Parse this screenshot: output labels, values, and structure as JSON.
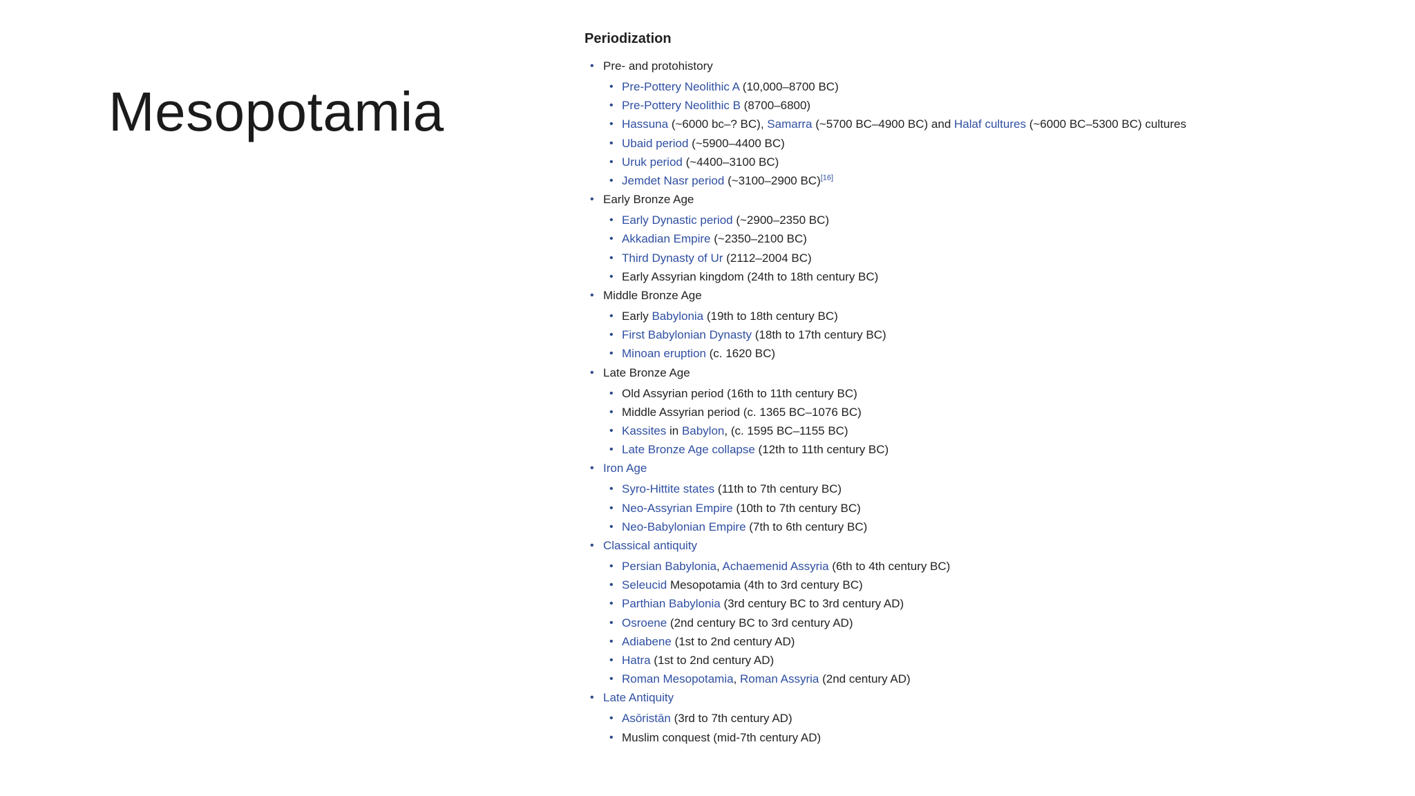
{
  "slide": {
    "title": "Mesopotamia"
  },
  "section": {
    "heading": "Periodization",
    "periods": [
      {
        "label": "Pre- and protohistory",
        "label_is_link": false,
        "entries": [
          [
            {
              "t": "Pre-Pottery Neolithic A",
              "link": true
            },
            {
              "t": " (10,000–8700 BC)",
              "link": false
            }
          ],
          [
            {
              "t": "Pre-Pottery Neolithic B",
              "link": true
            },
            {
              "t": " (8700–6800)",
              "link": false
            }
          ],
          [
            {
              "t": "Hassuna",
              "link": true
            },
            {
              "t": " (~6000 bc–? BC), ",
              "link": false
            },
            {
              "t": "Samarra",
              "link": true
            },
            {
              "t": " (~5700 BC–4900 BC) and ",
              "link": false
            },
            {
              "t": "Halaf cultures",
              "link": true
            },
            {
              "t": " (~6000 BC–5300 BC) cultures",
              "link": false
            }
          ],
          [
            {
              "t": "Ubaid period",
              "link": true
            },
            {
              "t": " (~5900–4400 BC)",
              "link": false
            }
          ],
          [
            {
              "t": "Uruk period",
              "link": true
            },
            {
              "t": " (~4400–3100 BC)",
              "link": false
            }
          ],
          [
            {
              "t": "Jemdet Nasr period",
              "link": true
            },
            {
              "t": " (~3100–2900 BC)",
              "link": false
            },
            {
              "t": "[16]",
              "ref": true
            }
          ]
        ]
      },
      {
        "label": "Early Bronze Age",
        "label_is_link": false,
        "entries": [
          [
            {
              "t": "Early Dynastic period",
              "link": true
            },
            {
              "t": " (~2900–2350 BC)",
              "link": false
            }
          ],
          [
            {
              "t": "Akkadian Empire",
              "link": true
            },
            {
              "t": " (~2350–2100 BC)",
              "link": false
            }
          ],
          [
            {
              "t": "Third Dynasty of Ur",
              "link": true
            },
            {
              "t": " (2112–2004 BC)",
              "link": false
            }
          ],
          [
            {
              "t": "Early Assyrian kingdom (24th to 18th century BC)",
              "link": false
            }
          ]
        ]
      },
      {
        "label": "Middle Bronze Age",
        "label_is_link": false,
        "entries": [
          [
            {
              "t": "Early ",
              "link": false
            },
            {
              "t": "Babylonia",
              "link": true
            },
            {
              "t": " (19th to 18th century BC)",
              "link": false
            }
          ],
          [
            {
              "t": "First Babylonian Dynasty",
              "link": true
            },
            {
              "t": " (18th to 17th century BC)",
              "link": false
            }
          ],
          [
            {
              "t": "Minoan eruption",
              "link": true
            },
            {
              "t": " (c. 1620 BC)",
              "link": false
            }
          ]
        ]
      },
      {
        "label": "Late Bronze Age",
        "label_is_link": false,
        "entries": [
          [
            {
              "t": "Old Assyrian period (16th to 11th century BC)",
              "link": false
            }
          ],
          [
            {
              "t": "Middle Assyrian period (c. 1365 BC–1076 BC)",
              "link": false
            }
          ],
          [
            {
              "t": "Kassites",
              "link": true
            },
            {
              "t": " in ",
              "link": false
            },
            {
              "t": "Babylon",
              "link": true
            },
            {
              "t": ", (c. 1595 BC–1155 BC)",
              "link": false
            }
          ],
          [
            {
              "t": "Late Bronze Age collapse",
              "link": true
            },
            {
              "t": " (12th to 11th century BC)",
              "link": false
            }
          ]
        ]
      },
      {
        "label": "Iron Age",
        "label_is_link": true,
        "entries": [
          [
            {
              "t": "Syro-Hittite states",
              "link": true
            },
            {
              "t": " (11th to 7th century BC)",
              "link": false
            }
          ],
          [
            {
              "t": "Neo-Assyrian Empire",
              "link": true
            },
            {
              "t": " (10th to 7th century BC)",
              "link": false
            }
          ],
          [
            {
              "t": "Neo-Babylonian Empire",
              "link": true
            },
            {
              "t": " (7th to 6th century BC)",
              "link": false
            }
          ]
        ]
      },
      {
        "label": "Classical antiquity",
        "label_is_link": true,
        "entries": [
          [
            {
              "t": "Persian Babylonia",
              "link": true
            },
            {
              "t": ", ",
              "link": false
            },
            {
              "t": "Achaemenid Assyria",
              "link": true
            },
            {
              "t": " (6th to 4th century BC)",
              "link": false
            }
          ],
          [
            {
              "t": "Seleucid",
              "link": true
            },
            {
              "t": " Mesopotamia (4th to 3rd century BC)",
              "link": false
            }
          ],
          [
            {
              "t": "Parthian Babylonia",
              "link": true
            },
            {
              "t": " (3rd century BC to 3rd century AD)",
              "link": false
            }
          ],
          [
            {
              "t": "Osroene",
              "link": true
            },
            {
              "t": " (2nd century BC to 3rd century AD)",
              "link": false
            }
          ],
          [
            {
              "t": "Adiabene",
              "link": true
            },
            {
              "t": " (1st to 2nd century AD)",
              "link": false
            }
          ],
          [
            {
              "t": "Hatra",
              "link": true
            },
            {
              "t": " (1st to 2nd century AD)",
              "link": false
            }
          ],
          [
            {
              "t": "Roman Mesopotamia",
              "link": true
            },
            {
              "t": ", ",
              "link": false
            },
            {
              "t": "Roman Assyria",
              "link": true
            },
            {
              "t": " (2nd century AD)",
              "link": false
            }
          ]
        ]
      },
      {
        "label": "Late Antiquity",
        "label_is_link": true,
        "entries": [
          [
            {
              "t": "Asōristān",
              "link": true
            },
            {
              "t": " (3rd to 7th century AD)",
              "link": false
            }
          ],
          [
            {
              "t": "Muslim conquest (mid-7th century AD)",
              "link": false
            }
          ]
        ]
      }
    ]
  },
  "colors": {
    "link": "#2f4fa1",
    "text": "#222222",
    "bullet": "#2a4a8a",
    "background": "#ffffff"
  }
}
